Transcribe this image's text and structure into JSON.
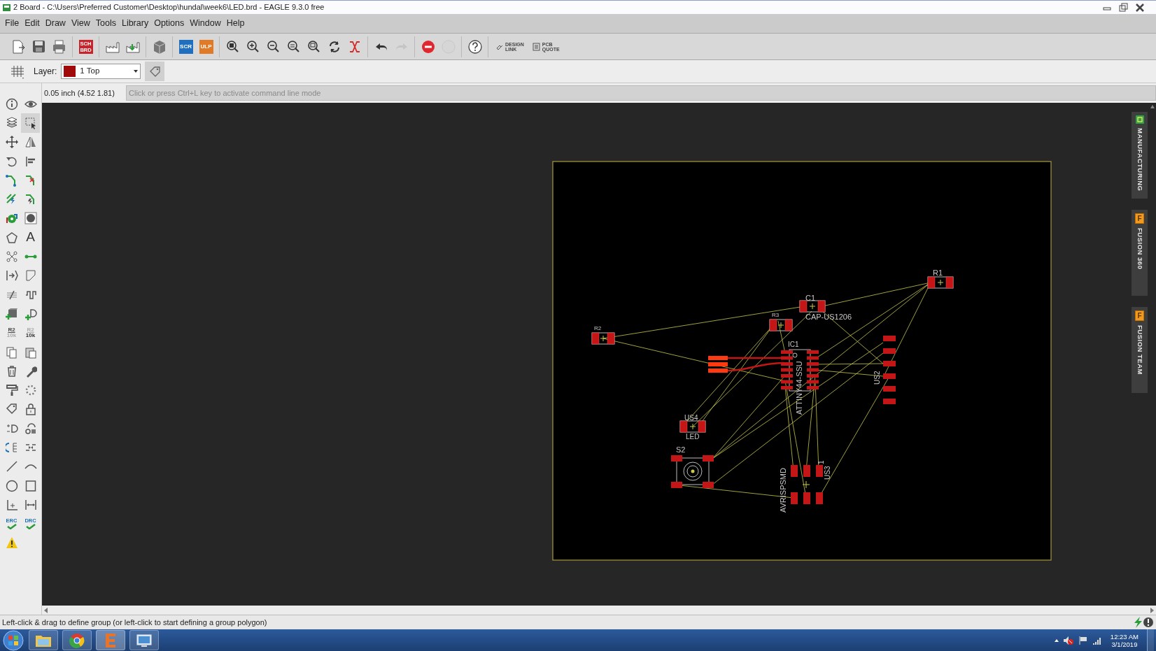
{
  "window": {
    "title": "2 Board - C:\\Users\\Preferred Customer\\Desktop\\hundal\\week6\\LED.brd - EAGLE 9.3.0 free"
  },
  "menu": [
    "File",
    "Edit",
    "Draw",
    "View",
    "Tools",
    "Library",
    "Options",
    "Window",
    "Help"
  ],
  "toolbar": {
    "sch_brd": [
      "SCH",
      "BRD"
    ],
    "scr": "SCR",
    "ulp": "ULP",
    "design_link": [
      "DESIGN",
      "LINK"
    ],
    "pcb_quote": [
      "PCB",
      "QUOTE"
    ]
  },
  "layer_bar": {
    "label": "Layer:",
    "layer": "1 Top"
  },
  "command": {
    "coordinates": "0.05 inch (4.52 1.81)",
    "placeholder": "Click or press Ctrl+L key to activate command line mode"
  },
  "left_toolbar": {
    "group_tool_selected": true,
    "text_tool": "A",
    "name_tool": [
      "R2",
      "10k"
    ],
    "value_tool": [
      "R2",
      "10k"
    ],
    "erc": "ERC",
    "drc": "DRC"
  },
  "board": {
    "labels": [
      "R1",
      "C1",
      "CAP-US1206",
      "R3",
      "R2",
      "IC1",
      "ATTINY44-SSU",
      "US4",
      "LED",
      "S2",
      "US2",
      "AVRISPSMD",
      "US3",
      "1"
    ]
  },
  "side_tabs": [
    {
      "kind": "manufacturing",
      "label": "MANUFACTURING"
    },
    {
      "kind": "fusion",
      "badge": "F",
      "label": "FUSION 360"
    },
    {
      "kind": "fusion",
      "badge": "F",
      "label": "FUSION TEAM"
    }
  ],
  "status_bar": {
    "text": "Left-click & drag to define group (or left-click to start defining a group polygon)"
  },
  "taskbar": {
    "time": "12:23 AM",
    "date": "3/1/2019"
  }
}
